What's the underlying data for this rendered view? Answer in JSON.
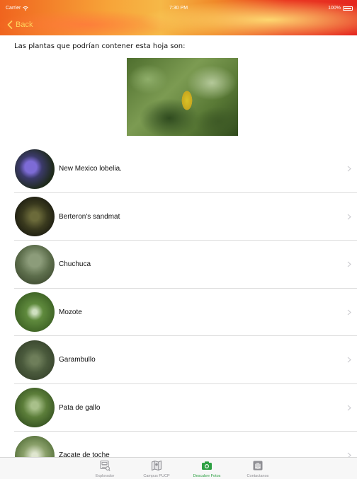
{
  "status": {
    "carrier": "Carrier",
    "time": "7:30 PM",
    "battery": "100%"
  },
  "nav": {
    "back_label": "Back"
  },
  "intro_text": "Las plantas que podrían contener esta hoja son:",
  "plants": [
    {
      "name": "New Mexico lobelia."
    },
    {
      "name": "Berteron's sandmat"
    },
    {
      "name": "Chuchuca"
    },
    {
      "name": "Mozote"
    },
    {
      "name": "Garambullo"
    },
    {
      "name": "Pata de gallo"
    },
    {
      "name": "Zacate de toche"
    }
  ],
  "tabs": [
    {
      "label": "Explorador",
      "icon": "explorer-icon"
    },
    {
      "label": "Campus PUCP",
      "icon": "map-icon"
    },
    {
      "label": "Descubre Fotos",
      "icon": "camera-icon",
      "active": true
    },
    {
      "label": "Contactanos",
      "icon": "hand-icon"
    }
  ],
  "colors": {
    "accent": "#2ea043",
    "back": "#ffd35c"
  }
}
